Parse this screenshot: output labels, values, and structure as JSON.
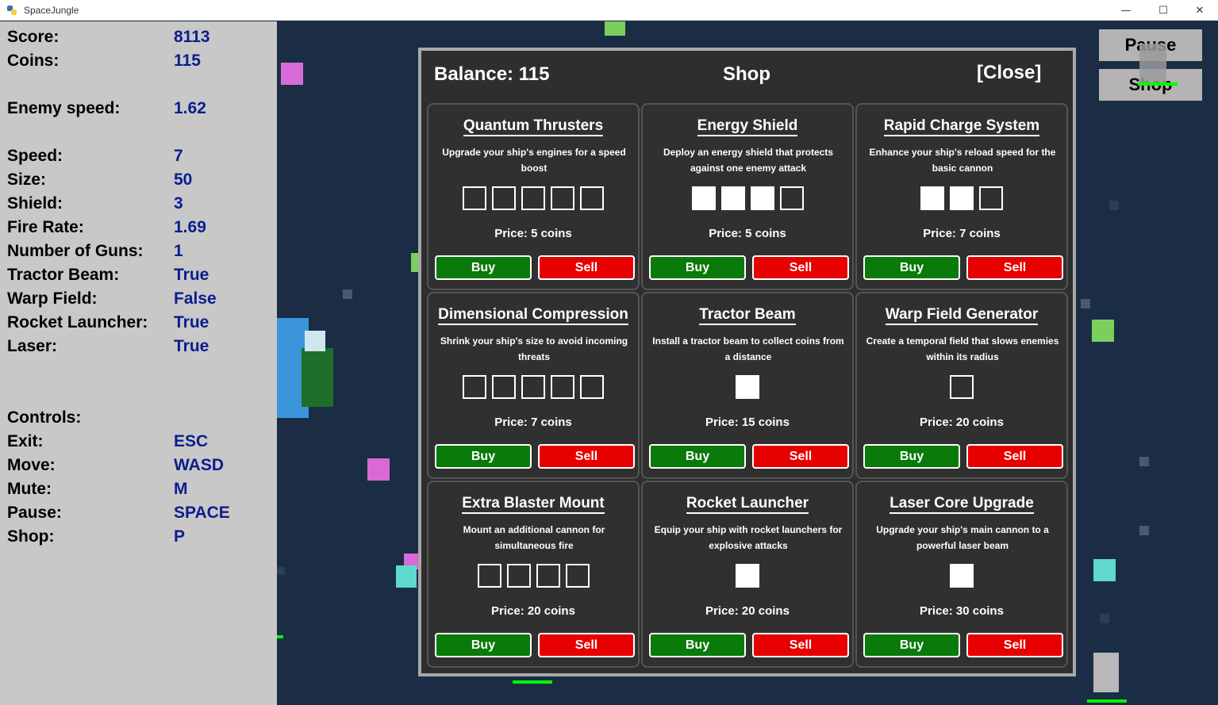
{
  "window": {
    "title": "SpaceJungle",
    "minimize": "—",
    "maximize": "☐",
    "close": "✕"
  },
  "stats": [
    {
      "label": "Score:",
      "value": "8113"
    },
    {
      "label": "Coins:",
      "value": "115"
    },
    {
      "label": "Enemy speed:",
      "value": "1.62"
    },
    {
      "label": "Speed:",
      "value": "7"
    },
    {
      "label": "Size:",
      "value": "50"
    },
    {
      "label": "Shield:",
      "value": "3"
    },
    {
      "label": "Fire Rate:",
      "value": "1.69"
    },
    {
      "label": "Number of Guns:",
      "value": "1"
    },
    {
      "label": "Tractor Beam:",
      "value": "True"
    },
    {
      "label": "Warp Field:",
      "value": "False"
    },
    {
      "label": "Rocket Launcher:",
      "value": "True"
    },
    {
      "label": "Laser:",
      "value": "True"
    }
  ],
  "controls": {
    "heading": "Controls:",
    "items": [
      {
        "label": "Exit:",
        "value": "ESC"
      },
      {
        "label": "Move:",
        "value": "WASD"
      },
      {
        "label": "Mute:",
        "value": "M"
      },
      {
        "label": "Pause:",
        "value": "SPACE"
      },
      {
        "label": "Shop:",
        "value": "P"
      }
    ]
  },
  "hud": {
    "pause_label": "Pause",
    "shop_label": "Shop"
  },
  "shop": {
    "balance": "Balance: 115",
    "title": "Shop",
    "close_label": "[Close]",
    "buy_label": "Buy",
    "sell_label": "Sell",
    "items": [
      {
        "name": "Quantum Thrusters",
        "desc": "Upgrade your ship's engines for a speed boost",
        "price": "Price: 5 coins",
        "max_level": 5,
        "level": 0
      },
      {
        "name": "Energy Shield",
        "desc": "Deploy an energy shield that protects against one enemy attack",
        "price": "Price: 5 coins",
        "max_level": 4,
        "level": 3
      },
      {
        "name": "Rapid Charge System",
        "desc": "Enhance your ship's reload speed for the basic cannon",
        "price": "Price: 7 coins",
        "max_level": 3,
        "level": 2
      },
      {
        "name": "Dimensional Compression",
        "desc": "Shrink your ship's size to avoid incoming threats",
        "price": "Price: 7 coins",
        "max_level": 5,
        "level": 0
      },
      {
        "name": "Tractor Beam",
        "desc": "Install a tractor beam to collect coins from a distance",
        "price": "Price: 15 coins",
        "max_level": 1,
        "level": 1
      },
      {
        "name": "Warp Field Generator",
        "desc": "Create a temporal field that slows enemies within its radius",
        "price": "Price: 20 coins",
        "max_level": 1,
        "level": 0
      },
      {
        "name": "Extra Blaster Mount",
        "desc": "Mount an additional cannon for simultaneous fire",
        "price": "Price: 20 coins",
        "max_level": 4,
        "level": 0
      },
      {
        "name": "Rocket Launcher",
        "desc": "Equip your ship with rocket launchers for explosive attacks",
        "price": "Price: 20 coins",
        "max_level": 1,
        "level": 1
      },
      {
        "name": "Laser Core Upgrade",
        "desc": "Upgrade your ship's main cannon to a powerful laser beam",
        "price": "Price: 30 coins",
        "max_level": 1,
        "level": 1
      }
    ]
  },
  "colors": {
    "stat_value": "#0a1e8c",
    "buy_green": "#0a7a0a",
    "sell_red": "#e60000",
    "space_bg": "#1a2d45",
    "panel_gray": "#c8c8c8"
  }
}
